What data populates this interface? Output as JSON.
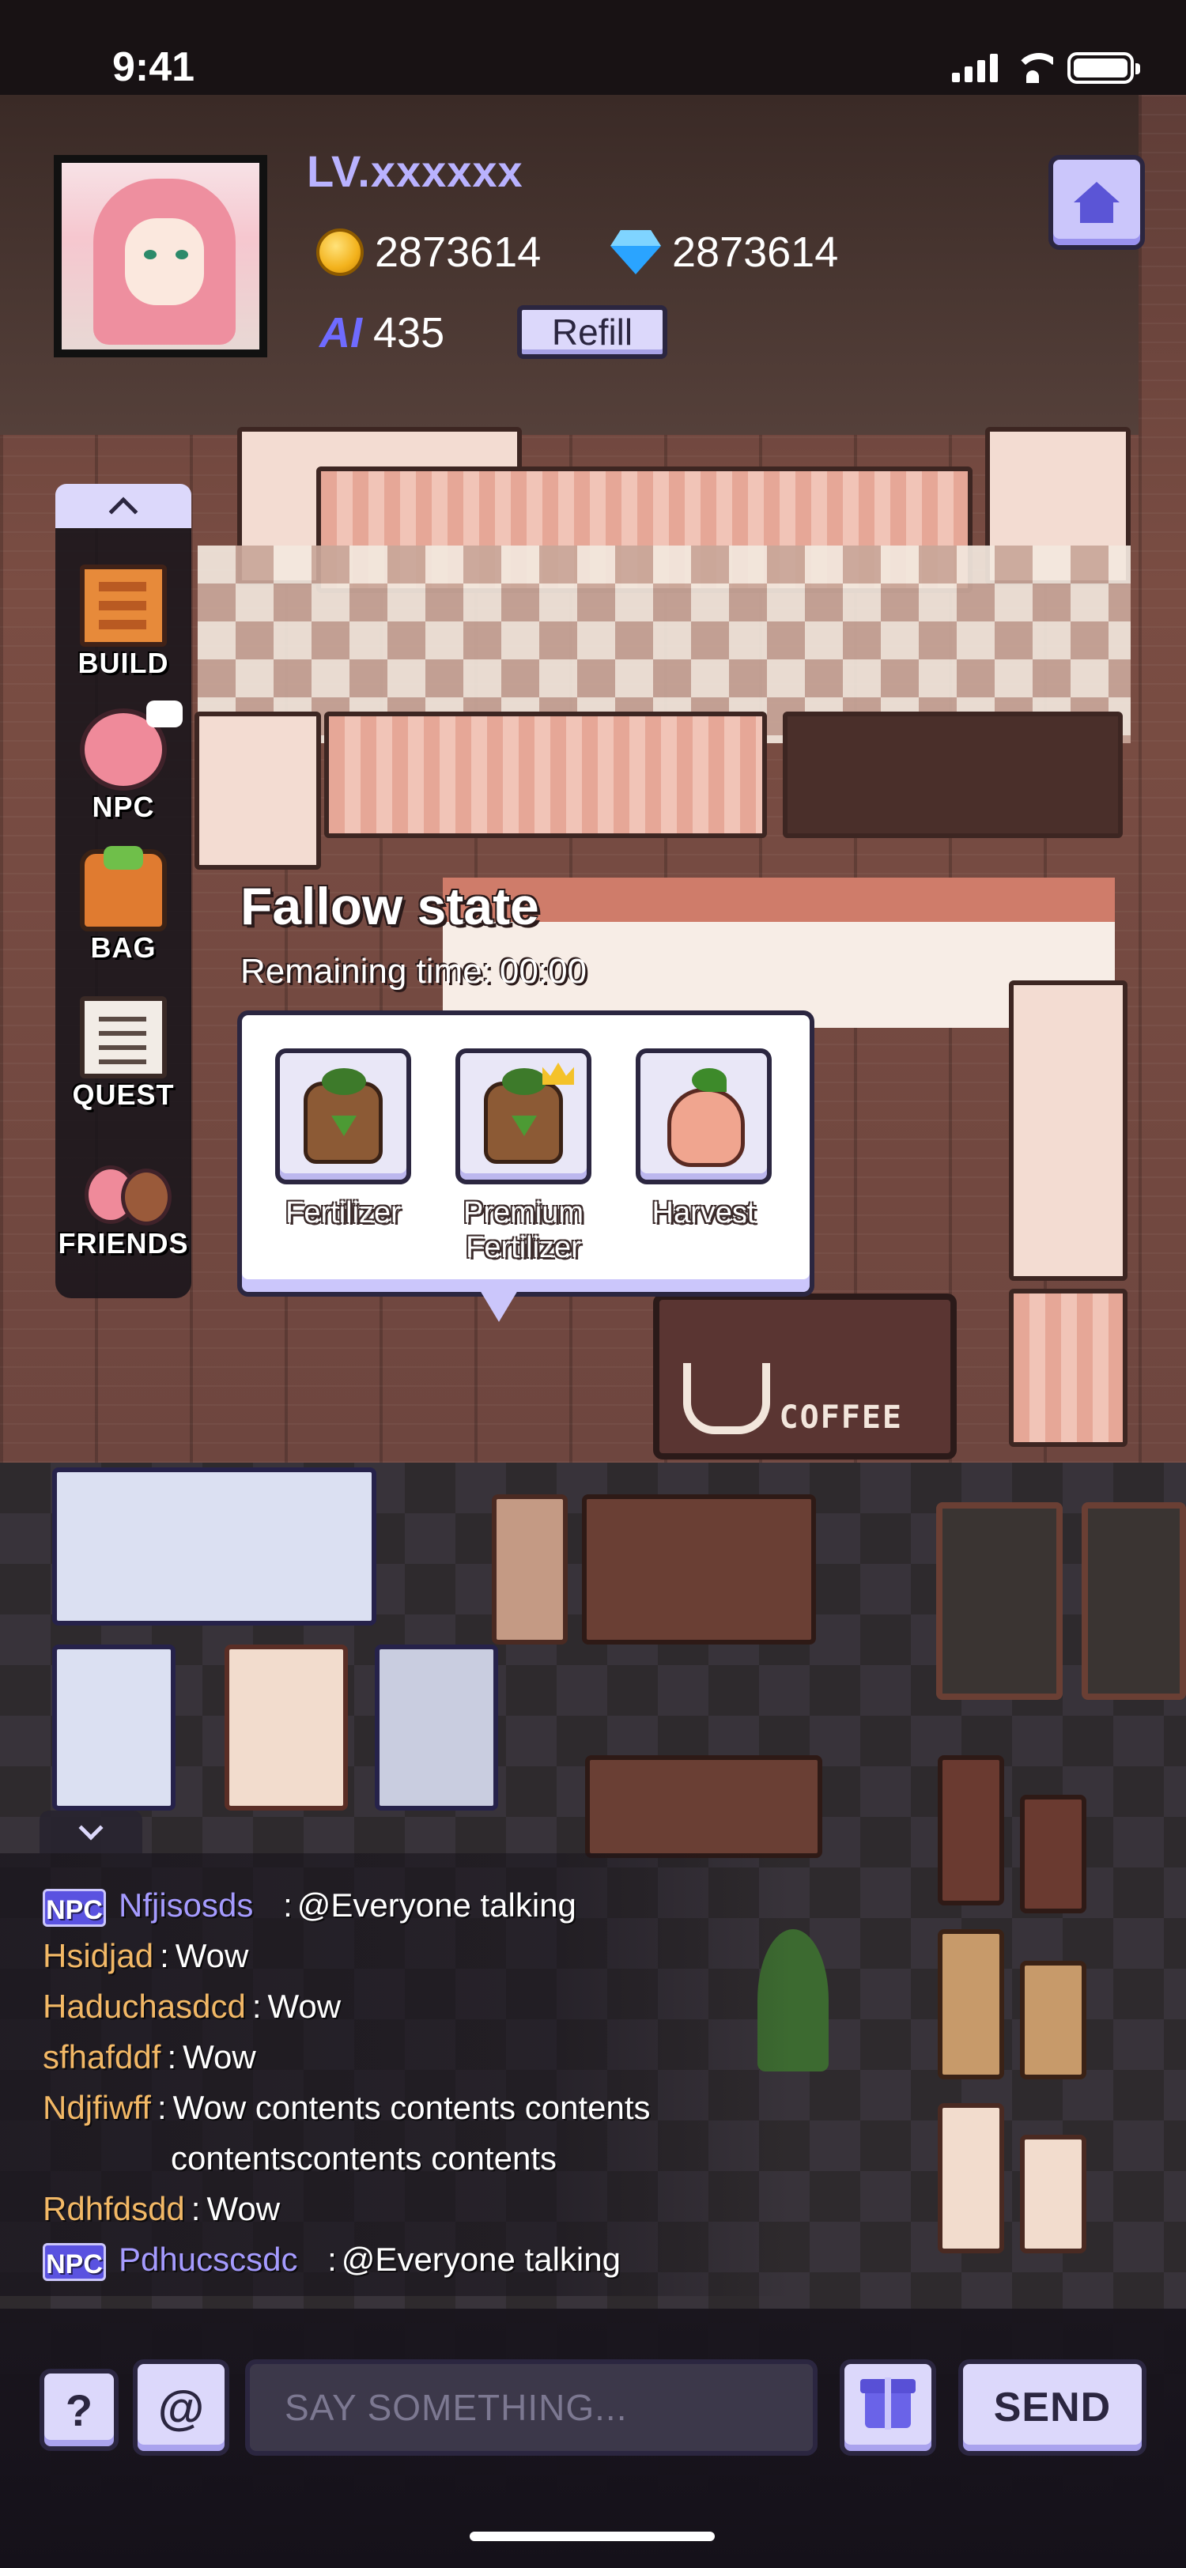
{
  "status_bar": {
    "time": "9:41"
  },
  "player": {
    "level_label": "LV.xxxxxx",
    "coins": "2873614",
    "gems": "2873614",
    "ai_label": "AI",
    "ai_points": "435",
    "refill_label": "Refill"
  },
  "side_menu": {
    "items": [
      {
        "label": "BUILD",
        "icon": "hammer-build-icon"
      },
      {
        "label": "NPC",
        "icon": "npc-girl-icon"
      },
      {
        "label": "BAG",
        "icon": "backpack-icon"
      },
      {
        "label": "QUEST",
        "icon": "clipboard-icon"
      },
      {
        "label": "FRIENDS",
        "icon": "friends-icon"
      }
    ]
  },
  "plot": {
    "state_title": "Fallow state",
    "remaining_label": "Remaining time:",
    "remaining_value": "00:00",
    "actions": [
      {
        "label": "Fertilizer",
        "icon": "fertilizer-sack-icon"
      },
      {
        "label": "Premium Fertilizer",
        "icon": "premium-fertilizer-icon"
      },
      {
        "label": "Harvest",
        "icon": "harvest-hand-icon"
      }
    ]
  },
  "scene": {
    "coffee_sign": "COFFEE"
  },
  "chat": {
    "npc_badge": "NPC",
    "separator": ":",
    "messages": [
      {
        "npc": true,
        "name": "Nfjisosds",
        "text": "@Everyone talking"
      },
      {
        "npc": false,
        "name": "Hsidjad",
        "text": "Wow"
      },
      {
        "npc": false,
        "name": "Haduchasdcd",
        "text": "Wow"
      },
      {
        "npc": false,
        "name": "sfhafddf",
        "text": "Wow"
      },
      {
        "npc": false,
        "name": "Ndjfiwff",
        "text": "Wow contents contents contents",
        "continuation": "contentscontents contents"
      },
      {
        "npc": false,
        "name": "Rdhfdsdd",
        "text": "Wow"
      },
      {
        "npc": true,
        "name": "Pdhucscsdc",
        "text": "@Everyone talking"
      }
    ]
  },
  "bottom_bar": {
    "help_label": "?",
    "at_label": "@",
    "input_placeholder": "SAY SOMETHING...",
    "send_label": "SEND"
  },
  "colors": {
    "accent": "#5a52e0",
    "button_bg": "#dcd8fb",
    "npc_name": "#a59bff",
    "user_name": "#f2b866",
    "level_text": "#b9b2ff"
  }
}
